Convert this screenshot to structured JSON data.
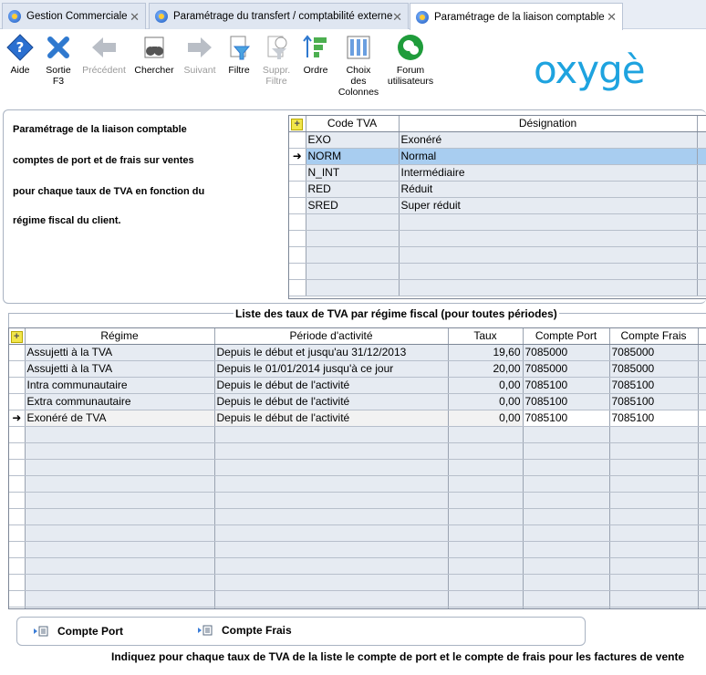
{
  "tabs": [
    {
      "label": "Gestion Commerciale",
      "active": false
    },
    {
      "label": "Paramétrage du transfert / comptabilité externe",
      "active": false
    },
    {
      "label": "Paramétrage de la liaison comptable",
      "active": true
    }
  ],
  "toolbar": {
    "aide": "Aide",
    "sortie_1": "Sortie",
    "sortie_2": "F3",
    "precedent": "Précédent",
    "chercher": "Chercher",
    "suivant": "Suivant",
    "filtre": "Filtre",
    "suppr_1": "Suppr.",
    "suppr_2": "Filtre",
    "ordre": "Ordre",
    "choix_1": "Choix",
    "choix_2": "des",
    "choix_3": "Colonnes",
    "forum_1": "Forum",
    "forum_2": "utilisateurs"
  },
  "logo": "oxygè",
  "description": {
    "line1": "Paramétrage de la liaison comptable",
    "line2": "comptes de port et de frais sur ventes",
    "line3": "pour chaque taux de TVA en fonction du",
    "line4": "régime fiscal du client."
  },
  "tva_grid": {
    "headers": {
      "code": "Code TVA",
      "designation": "Désignation"
    },
    "rows": [
      {
        "code": "EXO",
        "designation": "Exonéré"
      },
      {
        "code": "NORM",
        "designation": "Normal"
      },
      {
        "code": "N_INT",
        "designation": "Intermédiaire"
      },
      {
        "code": "RED",
        "designation": "Réduit"
      },
      {
        "code": "SRED",
        "designation": "Super réduit"
      }
    ]
  },
  "regime_section": {
    "title": "Liste des taux de TVA par régime fiscal (pour toutes périodes)",
    "headers": {
      "regime": "Régime",
      "periode": "Période d'activité",
      "taux": "Taux",
      "port": "Compte Port",
      "frais": "Compte Frais"
    },
    "rows": [
      {
        "regime": "Assujetti à la TVA",
        "periode": "Depuis le début et jusqu'au 31/12/2013",
        "taux": "19,60",
        "port": "7085000",
        "frais": "7085000"
      },
      {
        "regime": "Assujetti à la TVA",
        "periode": "Depuis le 01/01/2014 jusqu'à ce jour",
        "taux": "20,00",
        "port": "7085000",
        "frais": "7085000"
      },
      {
        "regime": "Intra communautaire",
        "periode": "Depuis le début de l'activité",
        "taux": "0,00",
        "port": "7085100",
        "frais": "7085100"
      },
      {
        "regime": "Extra communautaire",
        "periode": "Depuis le début de l'activité",
        "taux": "0,00",
        "port": "7085100",
        "frais": "7085100"
      },
      {
        "regime": "Exonéré de TVA",
        "periode": "Depuis le début de l'activité",
        "taux": "0,00",
        "port": "7085100",
        "frais": "7085100"
      }
    ]
  },
  "bottom": {
    "compte_port": "Compte Port",
    "compte_frais": "Compte Frais",
    "instruction": "Indiquez pour chaque taux de TVA de la liste le compte de port et le compte de frais pour les factures de vente"
  },
  "colors": {
    "accent": "#1ea3df",
    "selection": "#a8cdf0",
    "row": "#e6ebf2"
  }
}
